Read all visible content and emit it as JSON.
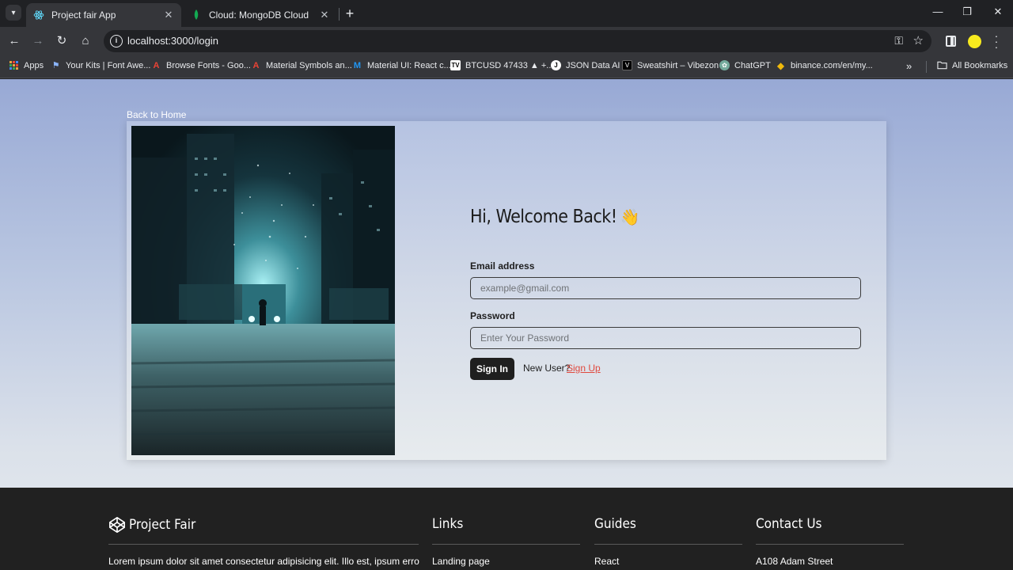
{
  "browser": {
    "tabs": [
      {
        "title": "Project fair App",
        "active": true
      },
      {
        "title": "Cloud: MongoDB Cloud",
        "active": false
      }
    ],
    "url": "localhost:3000/login",
    "bookmarks": [
      {
        "label": "Apps",
        "icon": "apps-grid-icon"
      },
      {
        "label": "Your Kits | Font Awe...",
        "icon": "flag-icon"
      },
      {
        "label": "Browse Fonts - Goo...",
        "icon": "google-fonts-icon"
      },
      {
        "label": "Material Symbols an...",
        "icon": "google-fonts-icon"
      },
      {
        "label": "Material UI: React c...",
        "icon": "mui-icon"
      },
      {
        "label": "BTCUSD 47433 ▲ +...",
        "icon": "tradingview-icon"
      },
      {
        "label": "JSON Data AI",
        "icon": "json-ai-icon"
      },
      {
        "label": "Sweatshirt – Vibezon",
        "icon": "vibezon-icon"
      },
      {
        "label": "ChatGPT",
        "icon": "chatgpt-icon"
      },
      {
        "label": "binance.com/en/my...",
        "icon": "binance-icon"
      }
    ],
    "all_bookmarks": "All Bookmarks"
  },
  "page": {
    "back_link": "Back to Home",
    "heading": "Hi, Welcome Back!",
    "wave": "👋",
    "email_label": "Email address",
    "email_placeholder": "example@gmail.com",
    "password_label": "Password",
    "password_placeholder": "Enter Your Password",
    "signin_label": "Sign In",
    "new_user_text": "New User?",
    "signup_label": "Sign Up"
  },
  "footer": {
    "brand": "Project Fair",
    "brand_text": "Lorem ipsum dolor sit amet consectetur adipisicing elit. Illo est, ipsum error",
    "links_heading": "Links",
    "links_first": "Landing page",
    "guides_heading": "Guides",
    "guides_first": "React",
    "contact_heading": "Contact Us",
    "contact_first": "A108 Adam Street"
  }
}
